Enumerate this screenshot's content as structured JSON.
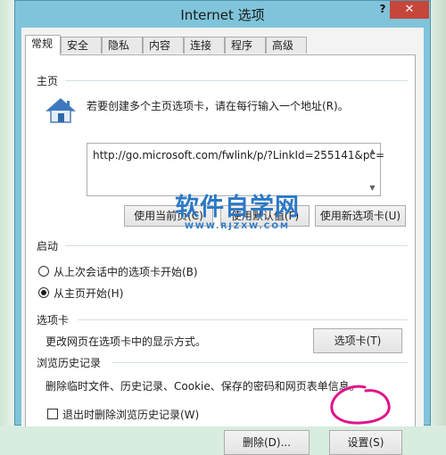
{
  "window": {
    "title": "Internet 选项",
    "help_label": "?",
    "close_label": "✕"
  },
  "tabs": [
    {
      "label": "常规",
      "active": true
    },
    {
      "label": "安全"
    },
    {
      "label": "隐私"
    },
    {
      "label": "内容"
    },
    {
      "label": "连接"
    },
    {
      "label": "程序"
    },
    {
      "label": "高级"
    }
  ],
  "homepage": {
    "group_label": "主页",
    "icon": "house-icon",
    "instruction": "若要创建多个主页选项卡，请在每行输入一个地址(R)。",
    "url_value": "http://go.microsoft.com/fwlink/p/?LinkId=255141&pc=",
    "use_current": "使用当前页(C)",
    "use_default": "使用默认值(F)",
    "use_new_tab": "使用新选项卡(U)"
  },
  "startup": {
    "group_label": "启动",
    "option_last_session": "从上次会话中的选项卡开始(B)",
    "option_home": "从主页开始(H)",
    "selected": "option_home"
  },
  "tabs_section": {
    "group_label": "选项卡",
    "description": "更改网页在选项卡中的显示方式。",
    "button": "选项卡(T)"
  },
  "history": {
    "group_label": "浏览历史记录",
    "description": "删除临时文件、历史记录、Cookie、保存的密码和网页表单信息。",
    "delete_on_exit": "退出时删除浏览历史记录(W)",
    "delete_on_exit_checked": false,
    "delete_button": "删除(D)...",
    "settings_button": "设置(S)"
  },
  "watermark": {
    "main": "软件自学网",
    "sub": "WWW.RJZXW.COM"
  },
  "colors": {
    "title_bar": "#7fc4da",
    "close_button": "#c7463b",
    "watermark": "#2b79c7",
    "scribble": "#e0148a"
  }
}
